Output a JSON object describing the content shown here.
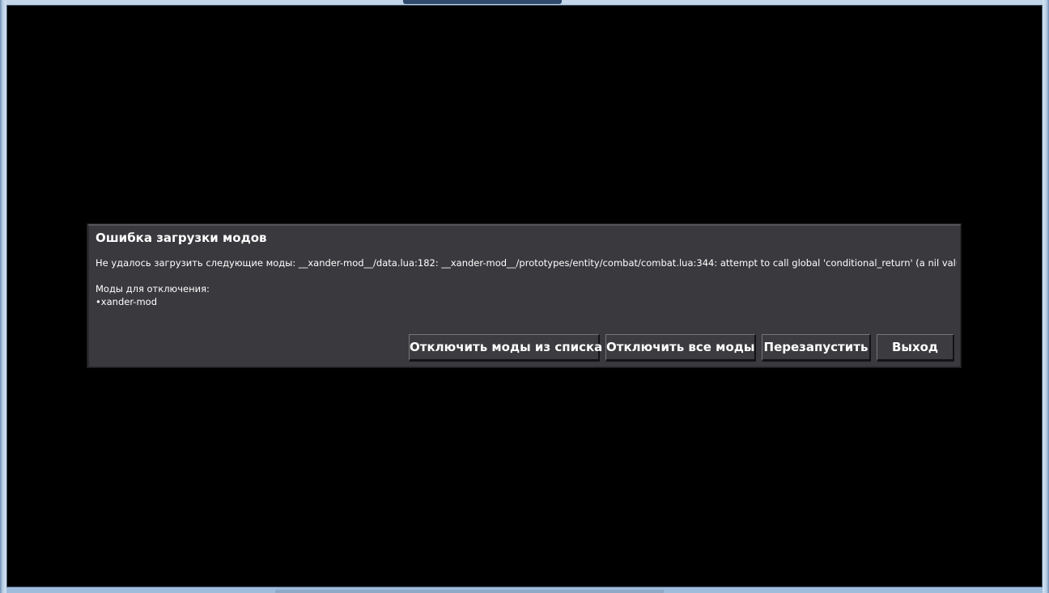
{
  "dialog": {
    "title": "Ошибка загрузки модов",
    "message": "Не удалось загрузить следующие моды: __xander-mod__/data.lua:182: __xander-mod__/prototypes/entity/combat/combat.lua:344: attempt to call global 'conditional_return' (a nil value)",
    "mods_label": "Моды для отключения:",
    "mods": [
      "xander-mod"
    ],
    "buttons": {
      "disable_listed": "Отключить моды из списка",
      "disable_all": "Отключить все моды",
      "restart": "Перезапустить",
      "exit": "Выход"
    }
  }
}
